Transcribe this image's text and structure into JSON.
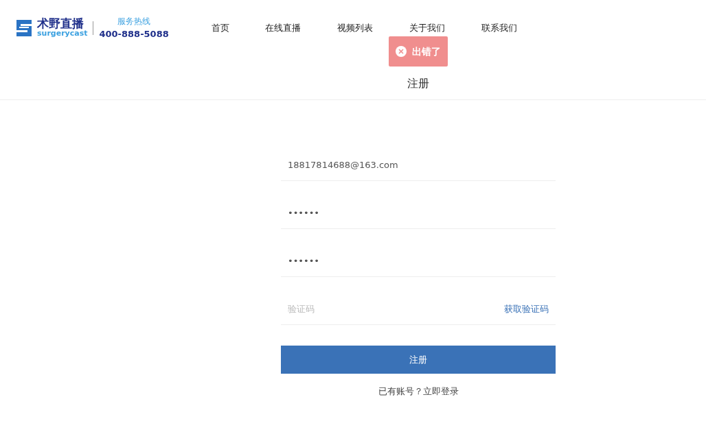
{
  "header": {
    "brand_name": "术野直播",
    "brand_sub": "surgerycast",
    "hotline_label": "服务热线",
    "hotline_number": "400-888-5088",
    "nav": [
      {
        "label": "首页",
        "selected": false
      },
      {
        "label": "在线直播",
        "selected": false
      },
      {
        "label": "视频列表",
        "selected": false
      },
      {
        "label": "关于我们",
        "selected": false
      },
      {
        "label": "联系我们",
        "selected": false
      }
    ]
  },
  "toast": {
    "text": "出错了"
  },
  "page_title": "注册",
  "form": {
    "fields": [
      {
        "kind": "text",
        "value": "18817814688@163.com"
      },
      {
        "kind": "password",
        "value": "••••••"
      },
      {
        "kind": "password",
        "value": "••••••"
      },
      {
        "kind": "code",
        "placeholder": "验证码",
        "action": "获取验证码"
      }
    ],
    "submit": "注册",
    "login_prompt": "已有账号？立即登录"
  }
}
